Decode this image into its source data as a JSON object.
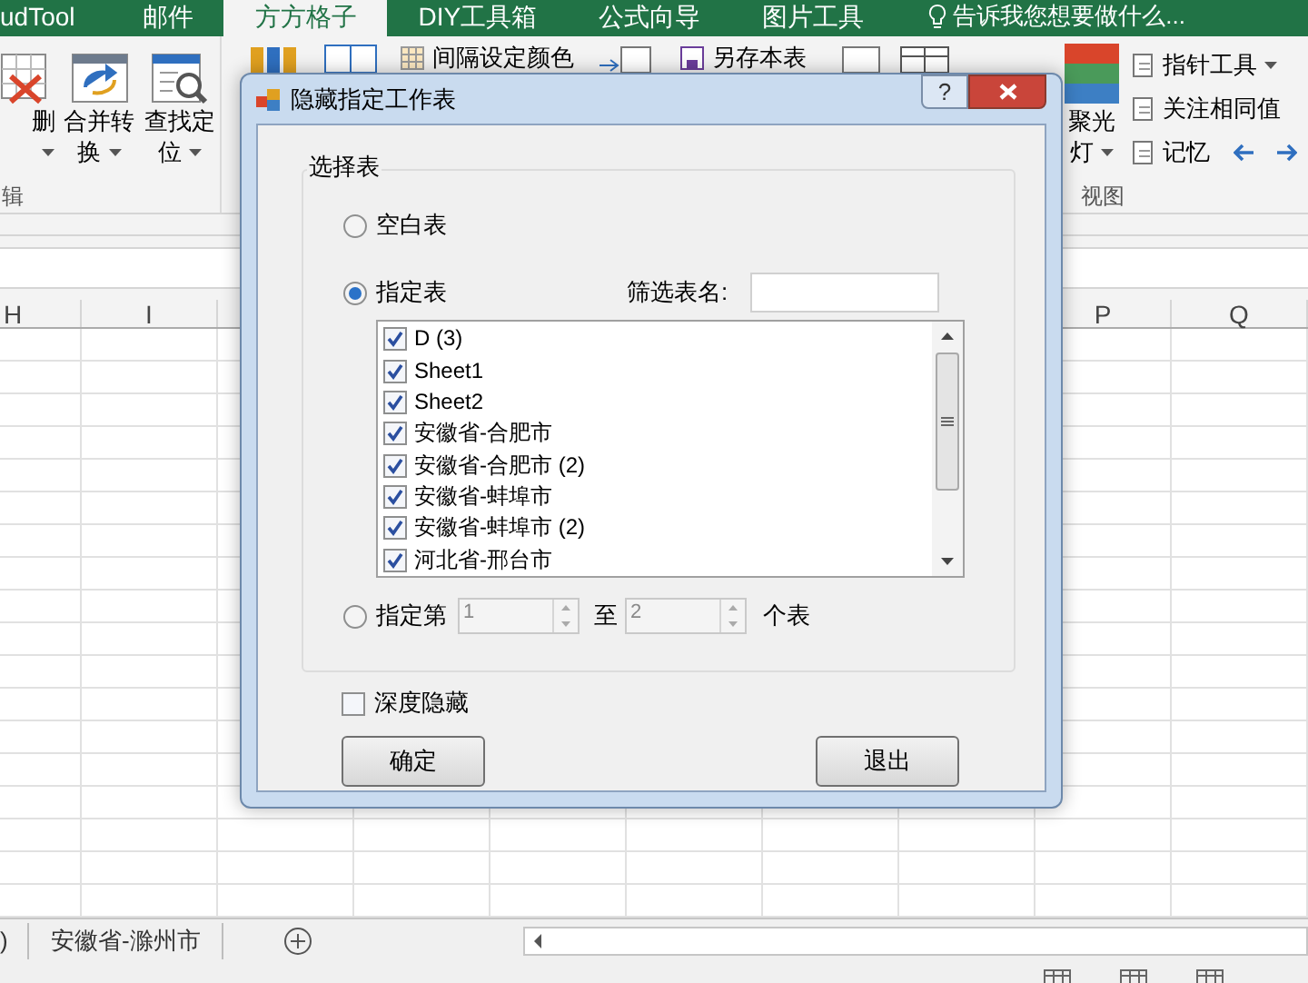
{
  "ribbon": {
    "tabs": [
      {
        "label": "udTool",
        "selected": false
      },
      {
        "label": "邮件",
        "selected": false
      },
      {
        "label": "方方格子",
        "selected": true
      },
      {
        "label": "DIY工具箱",
        "selected": false
      },
      {
        "label": "公式向导",
        "selected": false
      },
      {
        "label": "图片工具",
        "selected": false
      }
    ],
    "tell_me": "告诉我您想要做什么...",
    "left_buttons": [
      {
        "lines": [
          "删"
        ],
        "dropdown": true,
        "kind": "delete"
      },
      {
        "lines": [
          "合并转",
          "换"
        ],
        "dropdown": true,
        "kind": "convert"
      },
      {
        "lines": [
          "查找定",
          "位"
        ],
        "dropdown": true,
        "kind": "find"
      }
    ],
    "left_group_label": "辑",
    "top_items": [
      "间隔设定颜色",
      "另存本表"
    ],
    "view_large": {
      "lines": [
        "聚光",
        "灯"
      ],
      "dropdown": true
    },
    "view_small": [
      {
        "label": "指针工具",
        "dropdown": true
      },
      {
        "label": "关注相同值",
        "dropdown": false
      },
      {
        "label": "记忆",
        "dropdown": false
      }
    ],
    "view_group_label": "视图"
  },
  "columns_left": [
    "H",
    "I"
  ],
  "columns_right": [
    "P",
    "Q"
  ],
  "dialog": {
    "title": "隐藏指定工作表",
    "help": "?",
    "group_label": "选择表",
    "blank_option": {
      "label": "空白表",
      "selected": false
    },
    "named_option": {
      "label": "指定表",
      "selected": true
    },
    "filter_label": "筛选表名:",
    "sheets": [
      {
        "name": "D (3)",
        "checked": true
      },
      {
        "name": "Sheet1",
        "checked": true
      },
      {
        "name": "Sheet2",
        "checked": true
      },
      {
        "name": "安徽省-合肥市",
        "checked": true
      },
      {
        "name": "安徽省-合肥市 (2)",
        "checked": true
      },
      {
        "name": "安徽省-蚌埠市",
        "checked": true
      },
      {
        "name": "安徽省-蚌埠市 (2)",
        "checked": true
      },
      {
        "name": "河北省-邢台市",
        "checked": true
      }
    ],
    "range_option": {
      "label": "指定第",
      "selected": false,
      "from": "1",
      "to_label": "至",
      "to": "2",
      "suffix": "个表"
    },
    "deep_hide": {
      "label": "深度隐藏",
      "checked": false
    },
    "buttons": [
      "确定",
      "退出"
    ]
  },
  "sheet_tabs": [
    ")",
    "安徽省-滁州市"
  ]
}
